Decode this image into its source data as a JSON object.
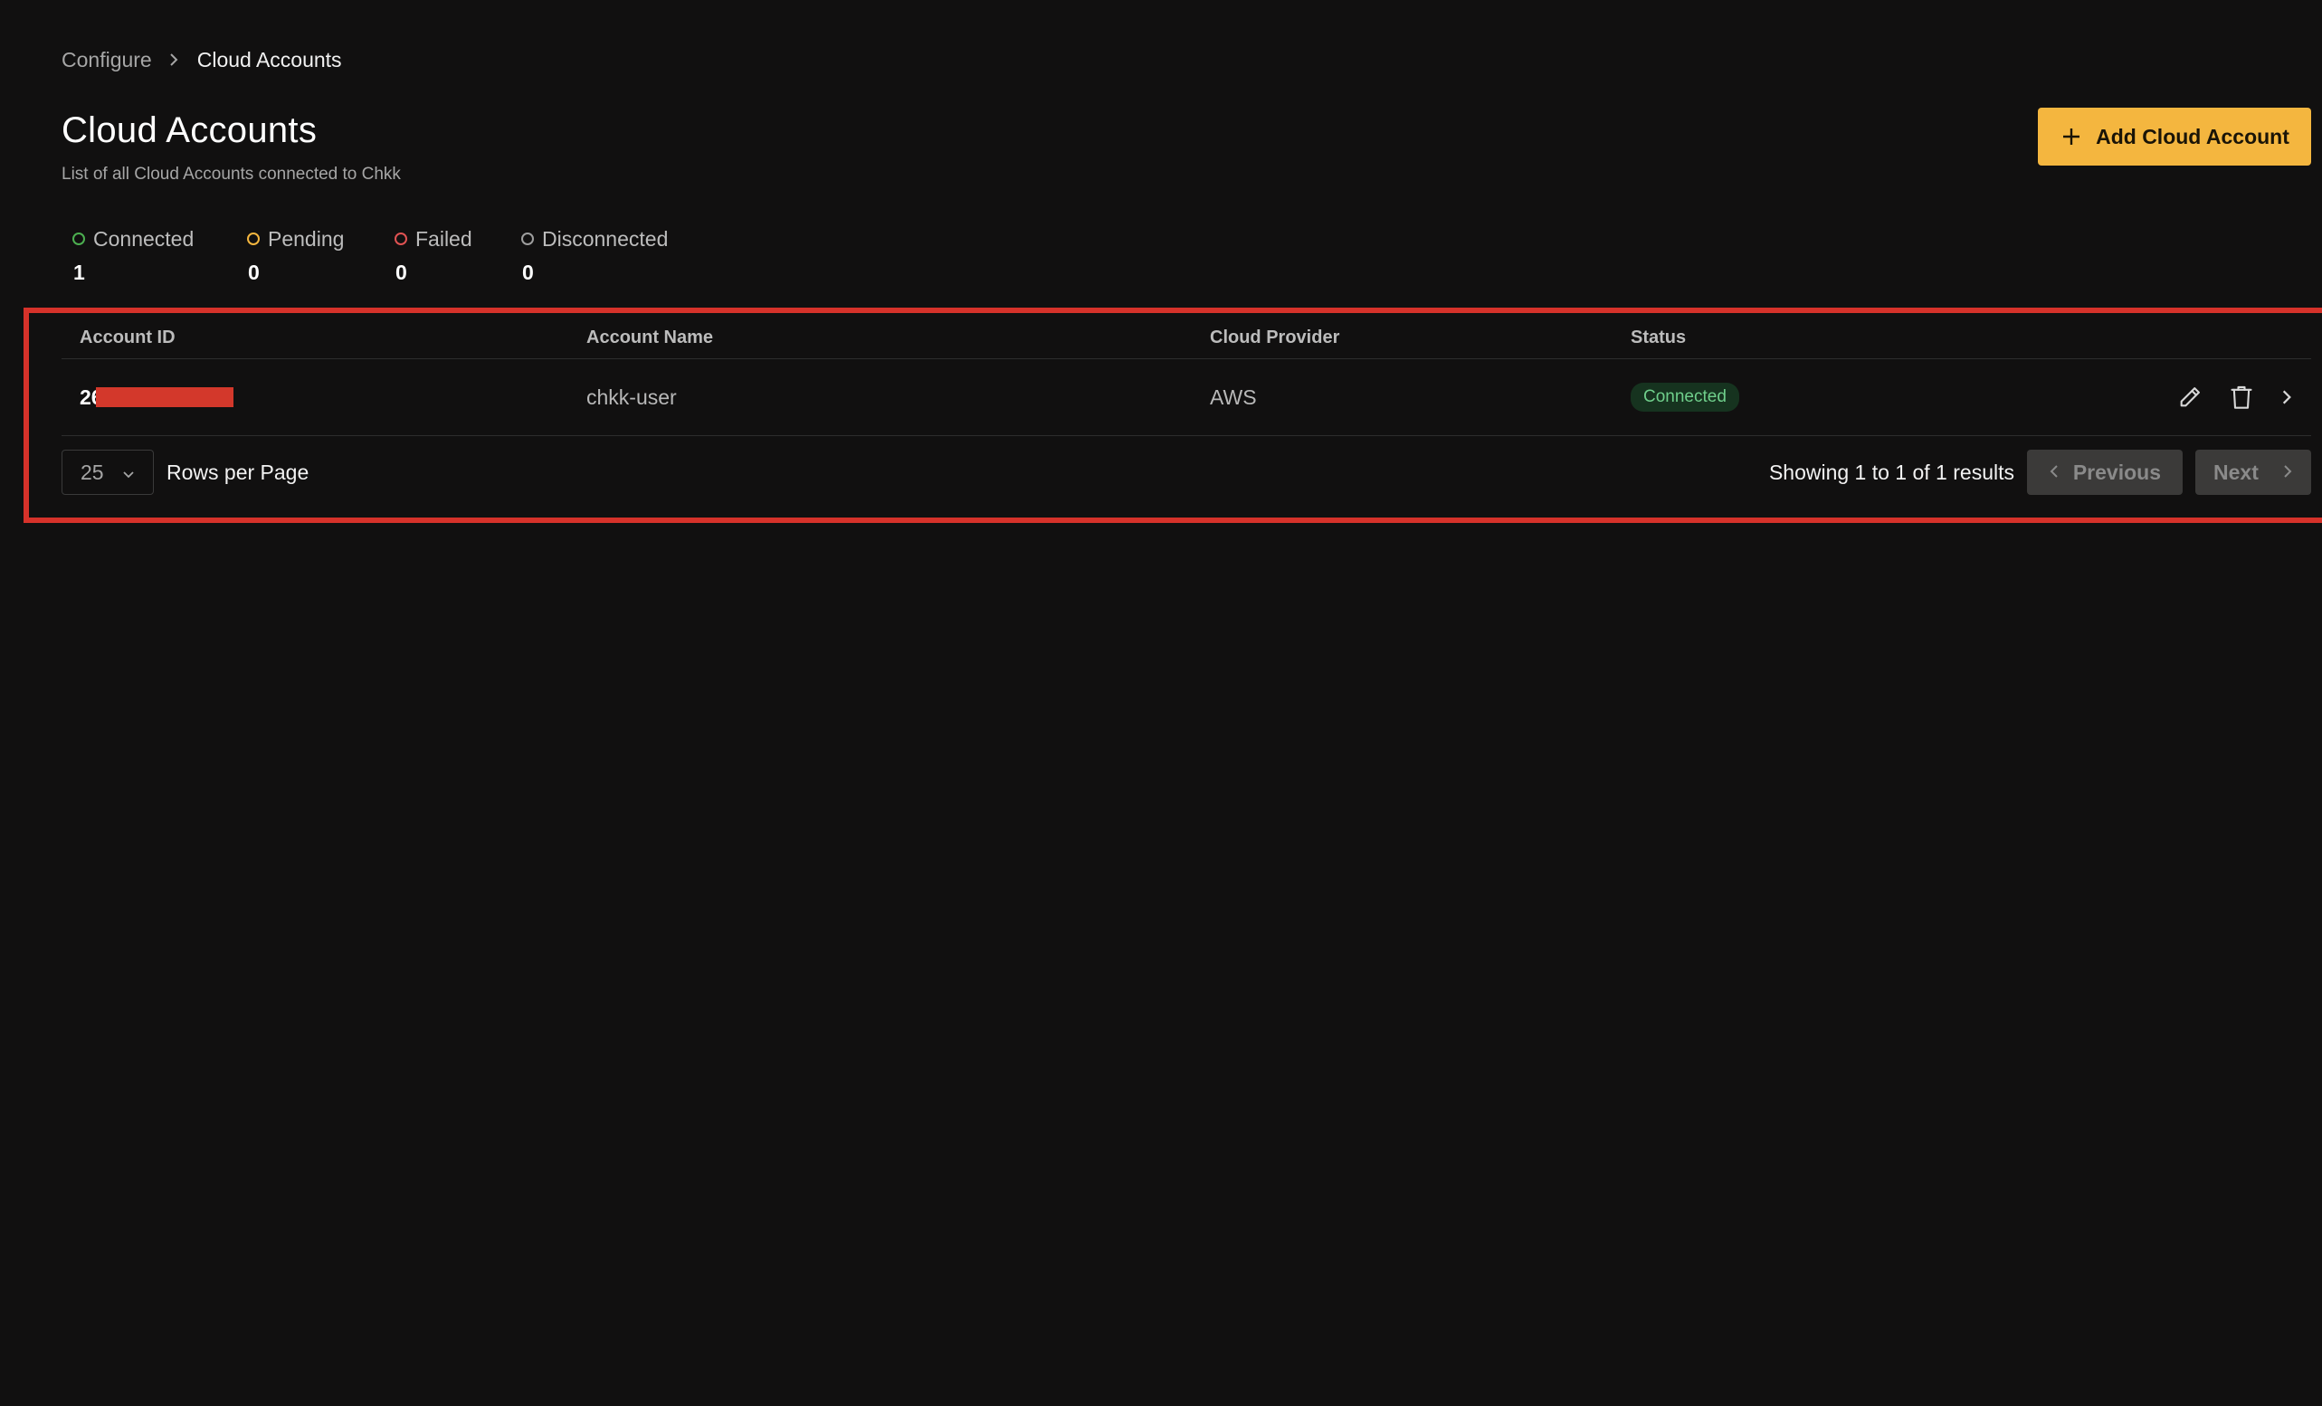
{
  "breadcrumb": {
    "parent": "Configure",
    "current": "Cloud Accounts"
  },
  "header": {
    "title": "Cloud Accounts",
    "subtitle": "List of all Cloud Accounts connected to Chkk",
    "add_button_label": "Add Cloud Account"
  },
  "stats": [
    {
      "label": "Connected",
      "value": "1",
      "color": "#4caf50"
    },
    {
      "label": "Pending",
      "value": "0",
      "color": "#f4b63f"
    },
    {
      "label": "Failed",
      "value": "0",
      "color": "#e05252"
    },
    {
      "label": "Disconnected",
      "value": "0",
      "color": "#9e9e9e"
    }
  ],
  "table": {
    "columns": [
      "Account ID",
      "Account Name",
      "Cloud Provider",
      "Status"
    ],
    "rows": [
      {
        "account_id": "26",
        "account_name": "chkk-user",
        "cloud_provider": "AWS",
        "status": "Connected"
      }
    ]
  },
  "pagination": {
    "rows_per_page": "25",
    "rows_per_page_label": "Rows per Page",
    "results_text": "Showing 1 to 1 of 1 results",
    "previous_label": "Previous",
    "next_label": "Next"
  },
  "colors": {
    "background": "#111010",
    "accent": "#f4b63f",
    "highlight": "#d6322a",
    "status_connected_bg": "#16331f",
    "status_connected_text": "#6fcf8b"
  }
}
